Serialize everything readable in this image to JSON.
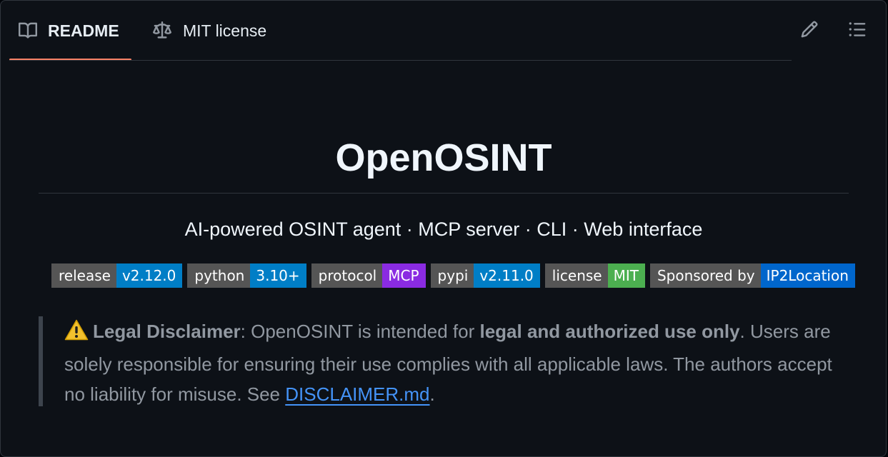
{
  "tabs": [
    {
      "label": "README",
      "icon": "book-icon",
      "active": true
    },
    {
      "label": "MIT license",
      "icon": "law-scale-icon",
      "active": false
    }
  ],
  "toolbar": {
    "edit_icon": "pencil-icon",
    "outline_icon": "list-outline-icon"
  },
  "readme": {
    "title": "OpenOSINT",
    "subtitle": "AI-powered OSINT agent · MCP server · CLI · Web interface",
    "badges": [
      {
        "label": "release",
        "value": "v2.12.0",
        "color": "#007ec6"
      },
      {
        "label": "python",
        "value": "3.10+",
        "color": "#007ec6"
      },
      {
        "label": "protocol",
        "value": "MCP",
        "color": "#8a2be2"
      },
      {
        "label": "pypi",
        "value": "v2.11.0",
        "color": "#007ec6"
      },
      {
        "label": "license",
        "value": "MIT",
        "color": "#4c1"
      },
      {
        "label": "Sponsored by",
        "value": "IP2Location",
        "color": "#0066cc"
      }
    ],
    "disclaimer": {
      "icon": "warning-icon",
      "heading": "Legal Disclaimer",
      "text1": ": OpenOSINT is intended for ",
      "emphasis": "legal and authorized use only",
      "text2": ". Users are solely responsible for ensuring their use complies with all applicable laws. The authors accept no liability for misuse. See ",
      "link_text": "DISCLAIMER.md",
      "text3": "."
    }
  },
  "colors": {
    "background": "#0d1117",
    "active_tab_underline": "#f78166",
    "link": "#4493f8"
  }
}
